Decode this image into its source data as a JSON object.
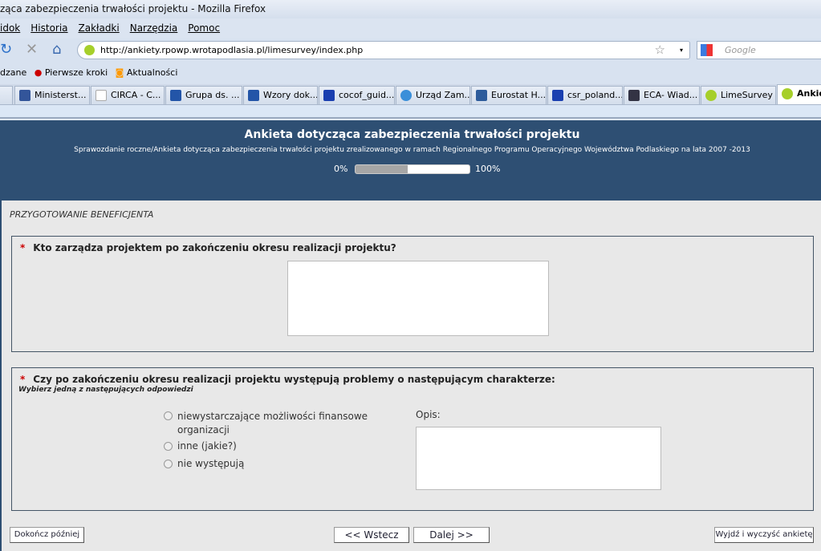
{
  "window": {
    "title": "ząca zabezpieczenia trwałości projektu - Mozilla Firefox"
  },
  "menu": [
    "idok",
    "Historia",
    "Zakładki",
    "Narzędzia",
    "Pomoc"
  ],
  "nav": {
    "url": "http://ankiety.rpowp.wrotapodlasia.pl/limesurvey/index.php",
    "search_placeholder": "Google"
  },
  "bookmarks": [
    "dzane",
    "Pierwsze kroki",
    "Aktualności"
  ],
  "tabs": [
    {
      "label": "...",
      "icon": "page-icon"
    },
    {
      "label": "Ministerst...",
      "icon": "mrr-icon"
    },
    {
      "label": "CIRCA - C...",
      "icon": "page-icon"
    },
    {
      "label": "Grupa ds. ...",
      "icon": "flag-icon"
    },
    {
      "label": "Wzory dok...",
      "icon": "flag-icon"
    },
    {
      "label": "cocof_guid...",
      "icon": "eu-icon"
    },
    {
      "label": "Urząd Zam...",
      "icon": "globe-icon"
    },
    {
      "label": "Eurostat H...",
      "icon": "eurostat-icon"
    },
    {
      "label": "csr_poland...",
      "icon": "eu-icon"
    },
    {
      "label": "ECA- Wiad...",
      "icon": "book-icon"
    },
    {
      "label": "LimeSurvey",
      "icon": "lime-icon"
    },
    {
      "label": "Ankie",
      "icon": "lime-icon",
      "active": true
    }
  ],
  "survey": {
    "title": "Ankieta dotycząca zabezpieczenia trwałości projektu",
    "subtitle": "Sprawozdanie roczne/Ankieta dotycząca zabezpieczenia trwałości projektu zrealizowanego w ramach Regionalnego Programu Operacyjnego Województwa Podlaskiego na lata 2007 -2013",
    "progress_min": "0%",
    "progress_max": "100%",
    "progress_percent": 46,
    "section": "PRZYGOTOWANIE BENEFICJENTA",
    "q1": {
      "required": "*",
      "text": "Kto zarządza projektem po zakończeniu okresu realizacji projektu?",
      "value": ""
    },
    "q2": {
      "required": "*",
      "text": "Czy po zakończeniu okresu realizacji projektu występują problemy o następującym charakterze:",
      "help": "Wybierz jedną z następujących odpowiedzi",
      "options": [
        "niewystarczające możliwości finansowe organizacji",
        "inne (jakie?)",
        "nie występują"
      ],
      "comment_label": "Opis:",
      "comment_value": ""
    },
    "buttons": {
      "later": "Dokończ później",
      "back": "<< Wstecz",
      "next": "Dalej >>",
      "exit": "Wyjdź i wyczyść ankietę"
    },
    "colors": {
      "header": "#2e4f73",
      "body": "#e8e8e8",
      "required": "#cc0000"
    }
  }
}
